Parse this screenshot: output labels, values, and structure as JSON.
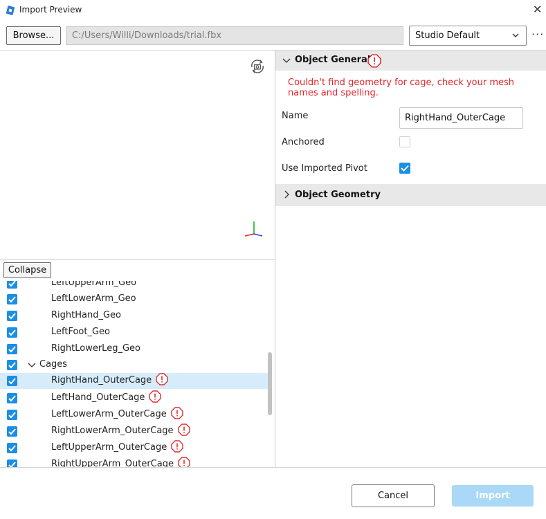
{
  "window": {
    "title": "Import Preview",
    "app_icon": "roblox-studio-logo",
    "close_icon": "✕"
  },
  "toolbar": {
    "browse_label": "Browse...",
    "file_path": "C:/Users/Willi/Downloads/trial.fbx",
    "preset_value": "Studio Default",
    "more_icon": "···"
  },
  "tree": {
    "collapse_label": "Collapse",
    "rows": [
      {
        "label": "LeftUpperArm_Geo",
        "checked": true,
        "warning": false
      },
      {
        "label": "LeftLowerArm_Geo",
        "checked": true,
        "warning": false
      },
      {
        "label": "RightHand_Geo",
        "checked": true,
        "warning": false
      },
      {
        "label": "LeftFoot_Geo",
        "checked": true,
        "warning": false
      },
      {
        "label": "RightLowerLeg_Geo",
        "checked": true,
        "warning": false
      },
      {
        "label": "Cages",
        "checked": true,
        "warning": false,
        "group": true
      },
      {
        "label": "RightHand_OuterCage",
        "checked": true,
        "warning": true,
        "selected": true
      },
      {
        "label": "LeftHand_OuterCage",
        "checked": true,
        "warning": true
      },
      {
        "label": "LeftLowerArm_OuterCage",
        "checked": true,
        "warning": true
      },
      {
        "label": "RightLowerArm_OuterCage",
        "checked": true,
        "warning": true
      },
      {
        "label": "LeftUpperArm_OuterCage",
        "checked": true,
        "warning": true
      },
      {
        "label": "RightUpperArm_OuterCage",
        "checked": true,
        "warning": true
      }
    ]
  },
  "properties": {
    "general_title": "Object General",
    "error_message": "Couldn't find geometry for cage, check your mesh names and spelling.",
    "name_label": "Name",
    "name_value": "RightHand_OuterCage",
    "anchored_label": "Anchored",
    "anchored_checked": false,
    "pivot_label": "Use Imported Pivot",
    "pivot_checked": true,
    "geometry_title": "Object Geometry"
  },
  "footer": {
    "cancel_label": "Cancel",
    "import_label": "Import"
  },
  "colors": {
    "accent": "#1a8fe3",
    "error": "#e5262b",
    "selected_row": "#d6ecfb",
    "import_disabled": "#a9d9f6"
  }
}
